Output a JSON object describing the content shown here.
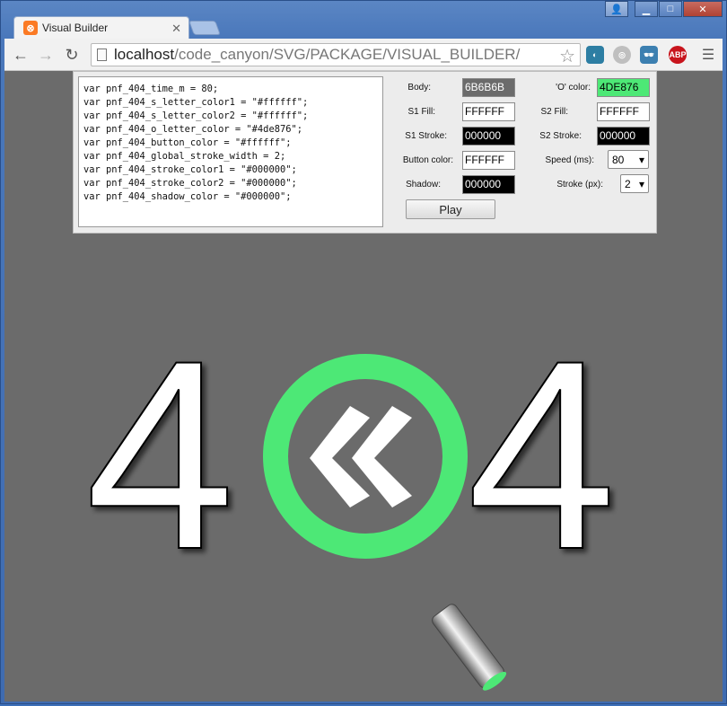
{
  "browser": {
    "tab_title": "Visual Builder",
    "url_host": "localhost",
    "url_path": "/code_canyon/SVG/PACKAGE/VISUAL_BUILDER/",
    "extensions": [
      "cloud-extension-icon",
      "circle-extension-icon",
      "spy-extension-icon",
      "adblock-plus-icon"
    ],
    "abp_label": "ABP"
  },
  "code_lines": [
    "var pnf_404_time_m = 80;",
    "var pnf_404_s_letter_color1 = \"#ffffff\";",
    "var pnf_404_s_letter_color2 = \"#ffffff\";",
    "var pnf_404_o_letter_color = \"#4de876\";",
    "var pnf_404_button_color = \"#ffffff\";",
    "var pnf_404_global_stroke_width = 2;",
    "var pnf_404_stroke_color1 = \"#000000\";",
    "var pnf_404_stroke_color2 = \"#000000\";",
    "var pnf_404_shadow_color = \"#000000\";"
  ],
  "fields": {
    "body": {
      "label": "Body:",
      "value": "6B6B6B",
      "bg": "#6b6b6b",
      "fg": "#ffffff"
    },
    "o_color": {
      "label": "'O' color:",
      "value": "4DE876",
      "bg": "#4de876",
      "fg": "#000000"
    },
    "s1_fill": {
      "label": "S1 Fill:",
      "value": "FFFFFF",
      "bg": "#ffffff",
      "fg": "#000000"
    },
    "s2_fill": {
      "label": "S2 Fill:",
      "value": "FFFFFF",
      "bg": "#ffffff",
      "fg": "#000000"
    },
    "s1_stroke": {
      "label": "S1 Stroke:",
      "value": "000000",
      "bg": "#000000",
      "fg": "#ffffff"
    },
    "s2_stroke": {
      "label": "S2 Stroke:",
      "value": "000000",
      "bg": "#000000",
      "fg": "#ffffff"
    },
    "button_color": {
      "label": "Button color:",
      "value": "FFFFFF",
      "bg": "#ffffff",
      "fg": "#000000"
    },
    "shadow": {
      "label": "Shadow:",
      "value": "000000",
      "bg": "#000000",
      "fg": "#ffffff"
    },
    "speed": {
      "label": "Speed (ms):",
      "value": "80"
    },
    "stroke": {
      "label": "Stroke (px):",
      "value": "2"
    }
  },
  "play_label": "Play",
  "graphic": {
    "digit_left": "4",
    "digit_right": "4",
    "body_color": "#6b6b6b",
    "letter_fill": "#ffffff",
    "letter_stroke": "#000000",
    "o_color": "#4de876"
  }
}
